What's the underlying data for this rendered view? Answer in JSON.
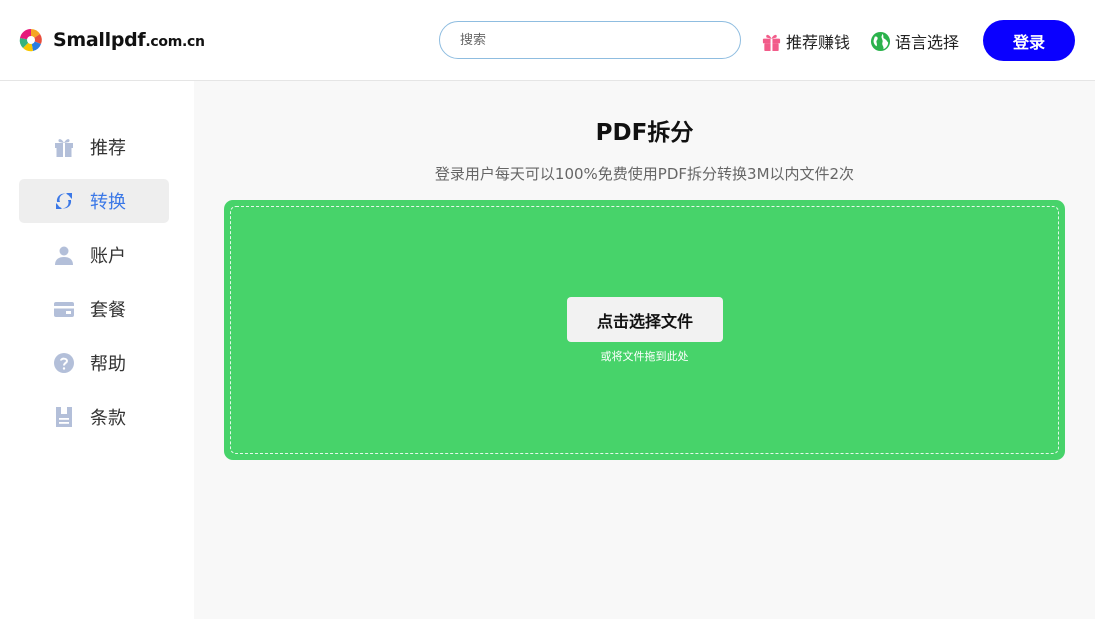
{
  "header": {
    "logo_text": "Smallpdf",
    "logo_suffix": ".com.cn",
    "search_placeholder": "搜索",
    "refer_label": "推荐赚钱",
    "language_label": "语言选择",
    "login_label": "登录"
  },
  "sidebar": {
    "items": [
      {
        "label": "推荐",
        "icon": "gift-icon"
      },
      {
        "label": "转换",
        "icon": "convert-icon",
        "active": true
      },
      {
        "label": "账户",
        "icon": "user-icon"
      },
      {
        "label": "套餐",
        "icon": "card-icon"
      },
      {
        "label": "帮助",
        "icon": "help-icon"
      },
      {
        "label": "条款",
        "icon": "document-icon"
      }
    ]
  },
  "main": {
    "title": "PDF拆分",
    "subtitle": "登录用户每天可以100%免费使用PDF拆分转换3M以内文件2次",
    "choose_button": "点击选择文件",
    "drop_hint": "或将文件拖到此处"
  },
  "colors": {
    "accent": "#0a00ff",
    "dropzone": "#47d36a",
    "active_item": "#3b78e7",
    "sidebar_icon": "#b3bfd9"
  }
}
